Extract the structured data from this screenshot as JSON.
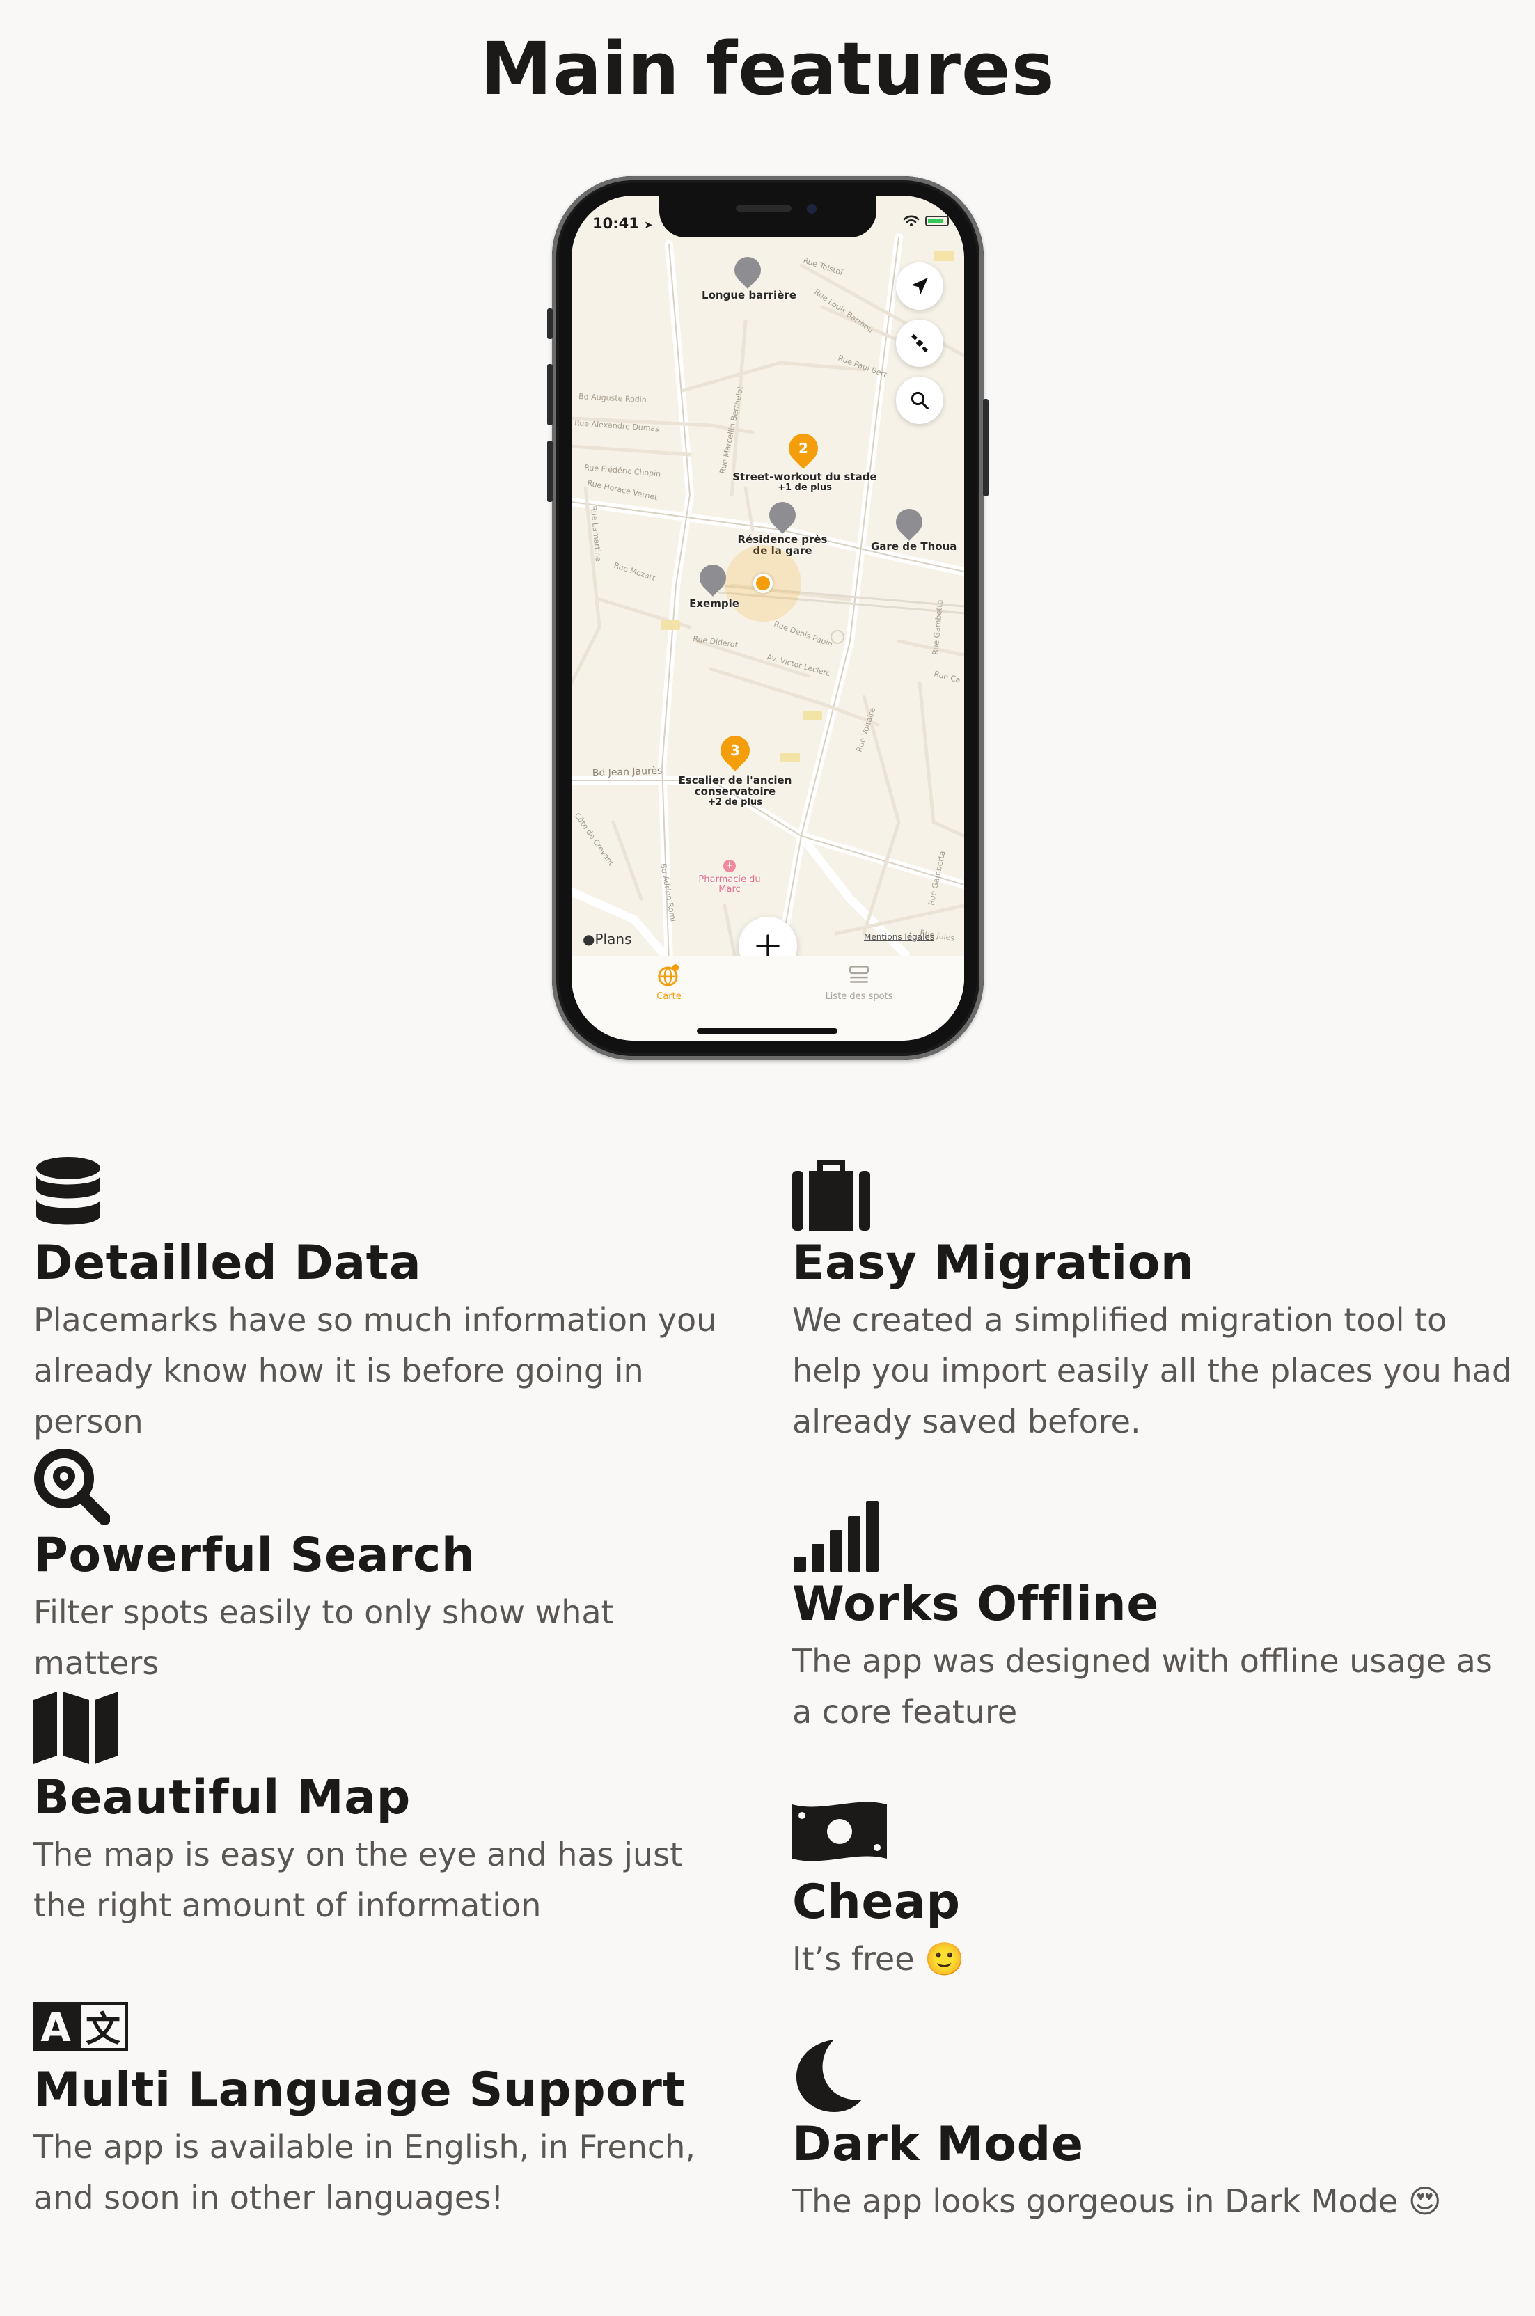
{
  "page_title": "Main features",
  "phone": {
    "status_time": "10:41",
    "map": {
      "streets": [
        "Rue Tolstoï",
        "Rue Louis Barthou",
        "Rue Paul Bert",
        "Rue Marcellin Berthelot",
        "Bd Auguste Rodin",
        "Rue Alexandre Dumas",
        "Rue Frédéric Chopin",
        "Rue Horace Vernet",
        "Rue Lamartine",
        "Rue Mozart",
        "Rue Denis Papin",
        "Rue Diderot",
        "Av. Victor Leclerc",
        "Bd Jean Jaurès",
        "Rue Voltaire",
        "Rue Gambetta",
        "Bd Adrien Romi",
        "Rue Jules",
        "Côte de Crevant",
        "Rue Ca"
      ],
      "pins": [
        {
          "label": "Longue barrière",
          "sub": ""
        },
        {
          "label": "Street-workout du stade",
          "sub": "+1 de plus",
          "count": "2"
        },
        {
          "label": "Résidence près de la gare",
          "sub": ""
        },
        {
          "label": "Gare de Thoua",
          "sub": ""
        },
        {
          "label": "Exemple",
          "sub": ""
        },
        {
          "label": "Escalier de l'ancien conservatoire",
          "sub": "+2 de plus",
          "count": "3"
        },
        {
          "label": "Pharmacie du Marc",
          "sub": ""
        }
      ],
      "plans_label": "Plans",
      "legal_label": "Mentions légales"
    },
    "tabs": [
      {
        "label": "Carte",
        "active": true
      },
      {
        "label": "Liste des spots",
        "active": false
      }
    ],
    "accent_color": "#f59e0b"
  },
  "features_left": [
    {
      "icon": "database-icon",
      "title": "Detailled Data",
      "description": "Placemarks have so much information you already know how it is before going in person"
    },
    {
      "icon": "search-location-icon",
      "title": "Powerful Search",
      "description": "Filter spots easily to only show what matters"
    },
    {
      "icon": "map-icon",
      "title": "Beautiful Map",
      "description": "The map is easy on the eye and has just the right amount of information"
    },
    {
      "icon": "language-icon",
      "title": "Multi Language Support",
      "description": "The app is available in English, in French, and soon in other languages!"
    }
  ],
  "features_right": [
    {
      "icon": "suitcase-icon",
      "title": "Easy Migration",
      "description": "We created a simplified migration tool to help you import easily all the places you had already saved before."
    },
    {
      "icon": "signal-icon",
      "title": "Works Offline",
      "description": "The app was designed with offline usage as a core feature"
    },
    {
      "icon": "money-bill-icon",
      "title": "Cheap",
      "description": "It’s free 🙂"
    },
    {
      "icon": "moon-icon",
      "title": "Dark Mode",
      "description": "The app looks gorgeous in Dark Mode 😍"
    }
  ],
  "language_icon_letters": [
    "A",
    "文"
  ]
}
